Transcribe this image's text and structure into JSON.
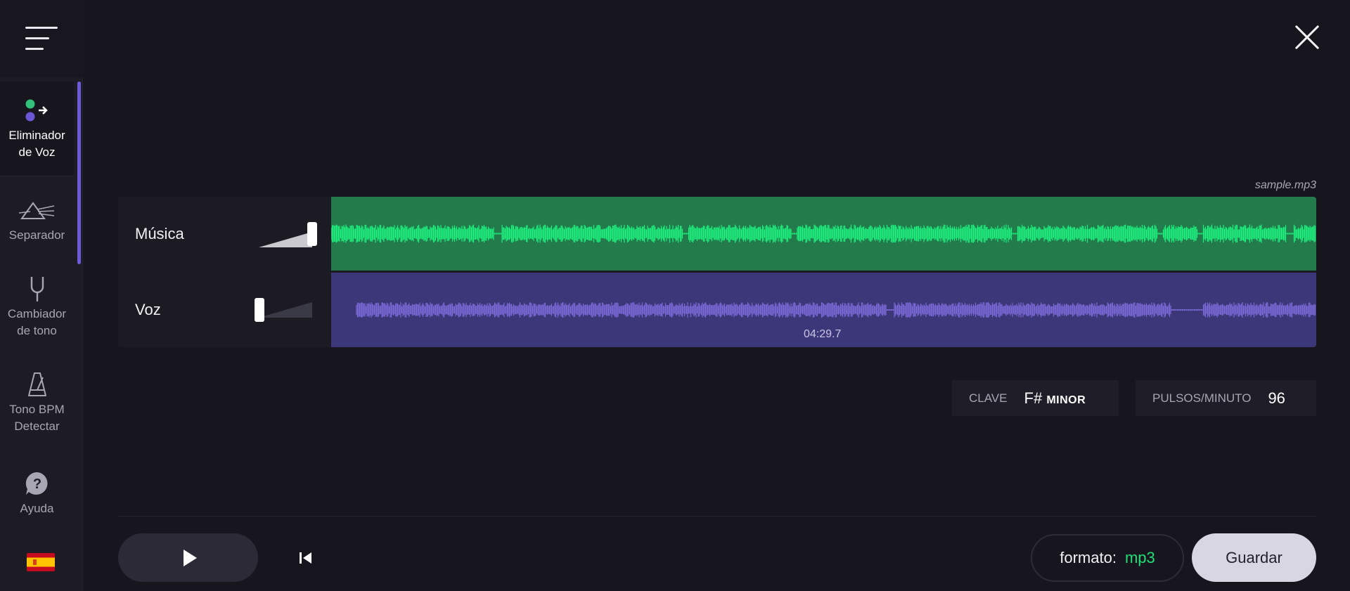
{
  "sidebar": {
    "items": [
      {
        "label_line1": "Eliminador",
        "label_line2": "de Voz",
        "icon": "voice-remover-icon",
        "active": true
      },
      {
        "label_line1": "Separador",
        "label_line2": "",
        "icon": "prism-icon",
        "active": false
      },
      {
        "label_line1": "Cambiador",
        "label_line2": "de tono",
        "icon": "tuning-fork-icon",
        "active": false
      },
      {
        "label_line1": "Tono BPM",
        "label_line2": "Detectar",
        "icon": "metronome-icon",
        "active": false
      }
    ],
    "help_label": "Ayuda",
    "language_flag": "spain-flag-icon"
  },
  "file": {
    "name": "sample.mp3"
  },
  "tracks": [
    {
      "name": "Música",
      "volume": 1.0,
      "color": "#237a4b",
      "wave_color": "#1df27f"
    },
    {
      "name": "Voz",
      "volume": 0.0,
      "color": "#3c3778",
      "wave_color": "#7b6ad8"
    }
  ],
  "playback": {
    "time": "04:29.7"
  },
  "info": {
    "key_label": "CLAVE",
    "key_note": "F#",
    "key_mode": "MINOR",
    "bpm_label": "PULSOS/MINUTO",
    "bpm_value": "96"
  },
  "bottom": {
    "format_label": "formato:",
    "format_value": "mp3",
    "save_label": "Guardar"
  },
  "colors": {
    "accent": "#6b5bd6",
    "music_wave": "#1df27f",
    "voice_wave": "#7b6ad8",
    "format_accent": "#21e07a"
  }
}
